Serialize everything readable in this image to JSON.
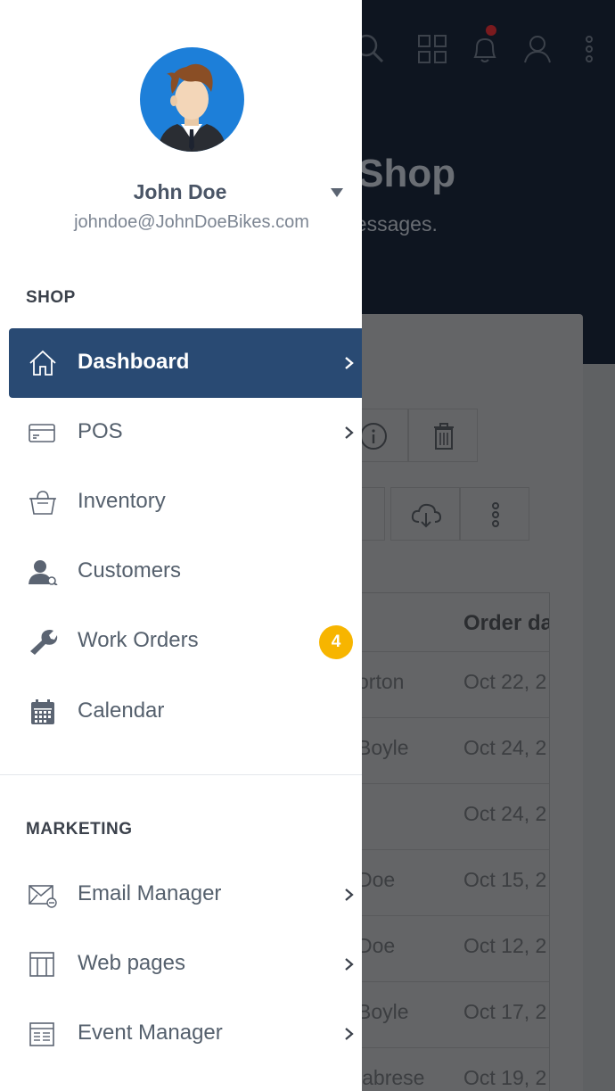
{
  "background": {
    "title_fragment": "ke Shop",
    "subtitle_fragment": "our messages.",
    "table": {
      "header": "Order da",
      "rows": [
        {
          "name": "orton",
          "date": "Oct 22, 2"
        },
        {
          "name": "Boyle",
          "date": "Oct 24, 2"
        },
        {
          "name": "",
          "date": "Oct 24, 2"
        },
        {
          "name": "Doe",
          "date": "Oct 15, 2"
        },
        {
          "name": "Doe",
          "date": "Oct 12, 2"
        },
        {
          "name": "Boyle",
          "date": "Oct 17, 2"
        },
        {
          "name": "labrese",
          "date": "Oct 19, 2"
        }
      ]
    }
  },
  "user": {
    "name": "John Doe",
    "email": "johndoe@JohnDoeBikes.com"
  },
  "sections": {
    "shop_label": "SHOP",
    "marketing_label": "MARKETING"
  },
  "nav": {
    "dashboard": {
      "label": "Dashboard",
      "icon": "home-icon"
    },
    "pos": {
      "label": "POS",
      "icon": "credit-card-icon"
    },
    "inventory": {
      "label": "Inventory",
      "icon": "basket-icon"
    },
    "customers": {
      "label": "Customers",
      "icon": "customer-icon"
    },
    "work_orders": {
      "label": "Work Orders",
      "icon": "wrench-icon",
      "badge": "4"
    },
    "calendar": {
      "label": "Calendar",
      "icon": "calendar-icon"
    },
    "email_manager": {
      "label": "Email Manager",
      "icon": "email-icon"
    },
    "web_pages": {
      "label": "Web pages",
      "icon": "web-page-icon"
    },
    "event_manager": {
      "label": "Event Manager",
      "icon": "event-list-icon"
    }
  },
  "colors": {
    "active_item": "#294a73",
    "badge": "#f7b500",
    "avatar_bg": "#1d7fd9",
    "notification_dot": "#c1272d"
  }
}
